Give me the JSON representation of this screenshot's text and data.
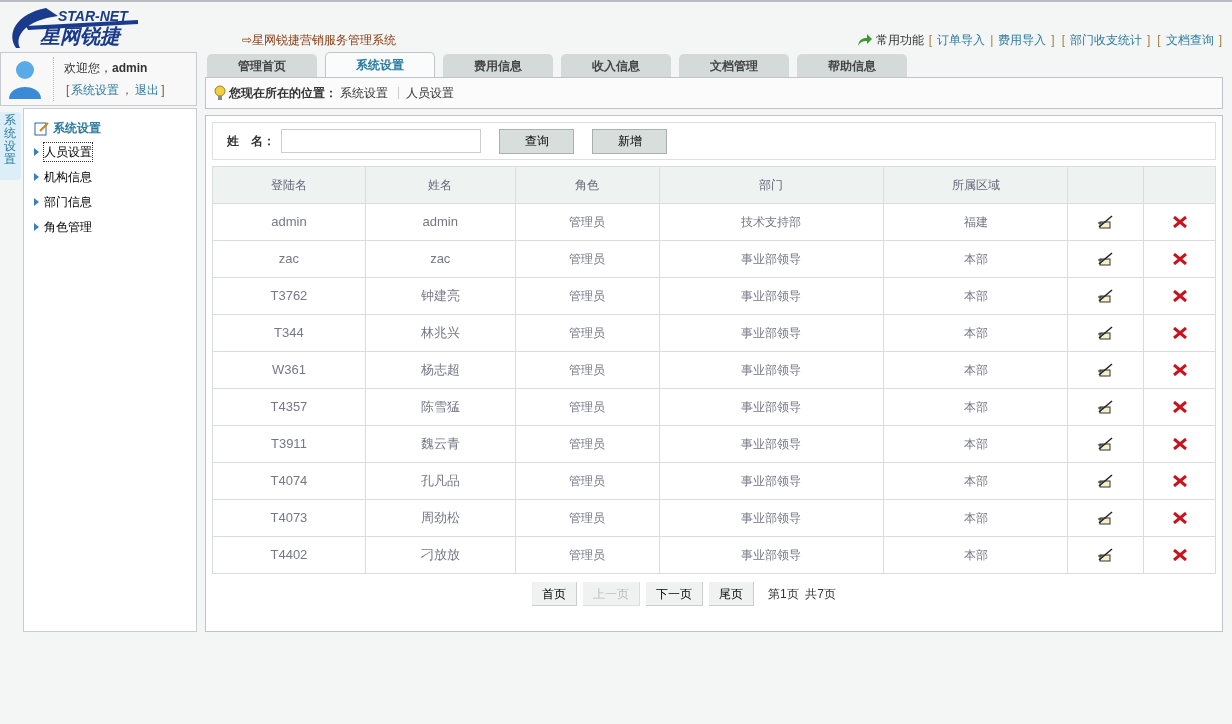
{
  "header": {
    "logo_en": "STAR-NET",
    "logo_cn": "星网锐捷",
    "system_title": "⇨星网锐捷营销服务管理系统",
    "quick_label": "常用功能",
    "quick_links": [
      {
        "kind": "mark",
        "text": "["
      },
      {
        "kind": "link",
        "text": "订单导入"
      },
      {
        "kind": "mark",
        "text": "|"
      },
      {
        "kind": "link",
        "text": "费用导入"
      },
      {
        "kind": "mark",
        "text": "]"
      },
      {
        "kind": "mark",
        "text": "["
      },
      {
        "kind": "link",
        "text": "部门收支统计"
      },
      {
        "kind": "mark",
        "text": "]"
      },
      {
        "kind": "mark",
        "text": "["
      },
      {
        "kind": "link",
        "text": "文档查询"
      },
      {
        "kind": "mark",
        "text": "]"
      }
    ]
  },
  "user": {
    "greeting": "欢迎您，",
    "name": "admin",
    "links": [
      {
        "kind": "mark",
        "text": "["
      },
      {
        "kind": "link",
        "text": "系统设置"
      },
      {
        "kind": "mark",
        "text": "，"
      },
      {
        "kind": "link",
        "text": "退出"
      },
      {
        "kind": "mark",
        "text": "]"
      }
    ]
  },
  "side_tab": "系统设置",
  "menu": {
    "title": "系统设置",
    "items": [
      {
        "label": "人员设置",
        "selected": true
      },
      {
        "label": "机构信息",
        "selected": false
      },
      {
        "label": "部门信息",
        "selected": false
      },
      {
        "label": "角色管理",
        "selected": false
      }
    ]
  },
  "tabs": [
    {
      "label": "管理首页",
      "selected": false
    },
    {
      "label": "系统设置",
      "selected": true
    },
    {
      "label": "费用信息",
      "selected": false
    },
    {
      "label": "收入信息",
      "selected": false
    },
    {
      "label": "文档管理",
      "selected": false
    },
    {
      "label": "帮助信息",
      "selected": false
    }
  ],
  "breadcrumb": {
    "label": "您现在所在的位置：",
    "path": [
      "系统设置",
      "人员设置"
    ]
  },
  "search": {
    "label": "姓　名：",
    "buttons": [
      "查询",
      "新增"
    ]
  },
  "table": {
    "columns": [
      "登陆名",
      "姓名",
      "角色",
      "部门",
      "所属区域"
    ],
    "rows": [
      [
        "admin",
        "admin",
        "管理员",
        "技术支持部",
        "福建"
      ],
      [
        "zac",
        "zac",
        "管理员",
        "事业部领导",
        "本部"
      ],
      [
        "T3762",
        "钟建亮",
        "管理员",
        "事业部领导",
        "本部"
      ],
      [
        "T344",
        "林兆兴",
        "管理员",
        "事业部领导",
        "本部"
      ],
      [
        "W361",
        "杨志超",
        "管理员",
        "事业部领导",
        "本部"
      ],
      [
        "T4357",
        "陈雪猛",
        "管理员",
        "事业部领导",
        "本部"
      ],
      [
        "T3911",
        "魏云青",
        "管理员",
        "事业部领导",
        "本部"
      ],
      [
        "T4074",
        "孔凡品",
        "管理员",
        "事业部领导",
        "本部"
      ],
      [
        "T4073",
        "周劲松",
        "管理员",
        "事业部领导",
        "本部"
      ],
      [
        "T4402",
        "刁放放",
        "管理员",
        "事业部领导",
        "本部"
      ]
    ]
  },
  "pager": {
    "buttons": [
      {
        "label": "首页",
        "disabled": false
      },
      {
        "label": "上一页",
        "disabled": true
      },
      {
        "label": "下一页",
        "disabled": false
      },
      {
        "label": "尾页",
        "disabled": false
      }
    ],
    "info": "第1页  共7页"
  }
}
